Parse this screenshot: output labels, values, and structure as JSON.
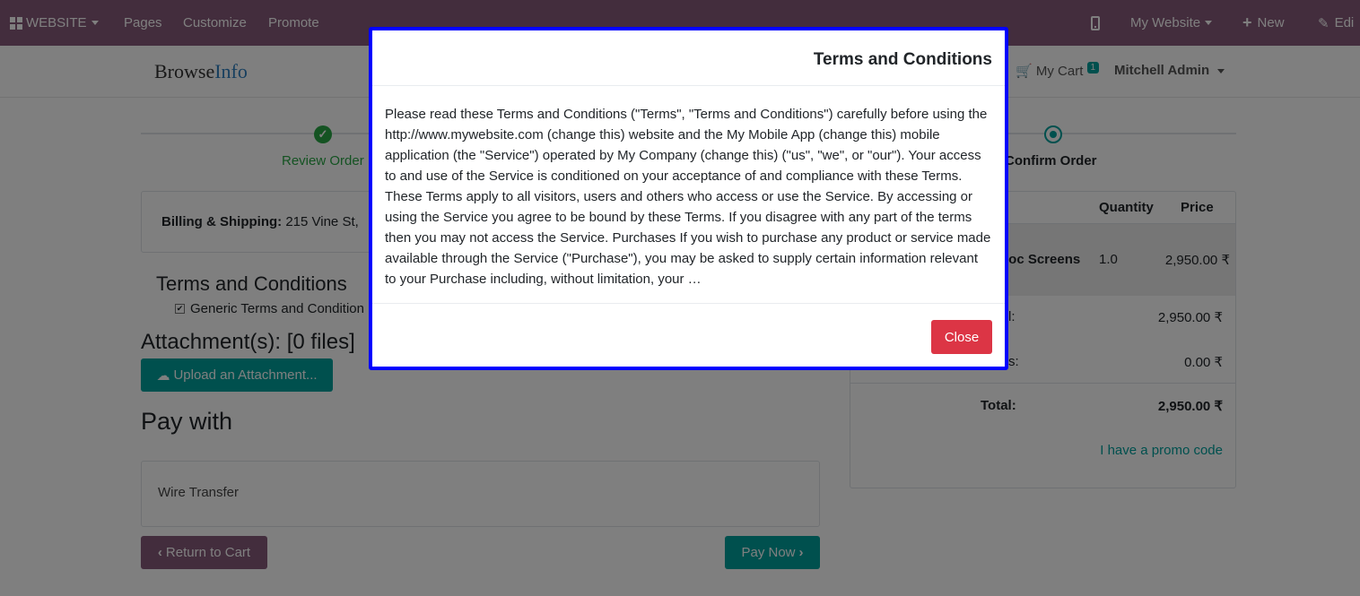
{
  "topbar": {
    "website_label": "WEBSITE",
    "pages_label": "Pages",
    "customize_label": "Customize",
    "promote_label": "Promote",
    "my_website_label": "My Website",
    "new_label": "New",
    "edit_label": "Edi"
  },
  "header": {
    "logo_part1": "Browse",
    "logo_part2": "Info",
    "cart_label": "My Cart",
    "cart_count": "1",
    "user_name": "Mitchell Admin"
  },
  "steps": {
    "review": "Review Order",
    "confirm": "Confirm Order"
  },
  "billing": {
    "label": "Billing & Shipping:",
    "address": "215 Vine St,"
  },
  "terms": {
    "title": "Terms and Conditions",
    "checkbox_label": "Generic Terms and Condition"
  },
  "attachments": {
    "title": "Attachment(s): [0 files]",
    "upload_label": "Upload an Attachment..."
  },
  "payment": {
    "title": "Pay with",
    "method": "Wire Transfer",
    "return_label": "Return to Cart",
    "pay_label": "Pay Now"
  },
  "summary": {
    "col_quantity": "Quantity",
    "col_price": "Price",
    "product_name": "loc Screens",
    "product_qty": "1.0",
    "product_price": "2,950.00 ₹",
    "subtotal_label": "l:",
    "subtotal_value": "2,950.00 ₹",
    "taxes_label": "s:",
    "taxes_value": "0.00 ₹",
    "total_label": "Total:",
    "total_value": "2,950.00 ₹",
    "promo_label": "I have a promo code"
  },
  "modal": {
    "title": "Terms and Conditions",
    "body": "Please read these Terms and Conditions (\"Terms\", \"Terms and Conditions\") carefully before using the http://www.mywebsite.com (change this) website and the My Mobile App (change this) mobile application (the \"Service\") operated by My Company (change this) (\"us\", \"we\", or \"our\"). Your access to and use of the Service is conditioned on your acceptance of and compliance with these Terms. These Terms apply to all visitors, users and others who access or use the Service. By accessing or using the Service you agree to be bound by these Terms. If you disagree with any part of the terms then you may not access the Service. Purchases If you wish to purchase any product or service made available through the Service (\"Purchase\"), you may be asked to supply certain information relevant to your Purchase including, without limitation, your …",
    "close_label": "Close"
  }
}
